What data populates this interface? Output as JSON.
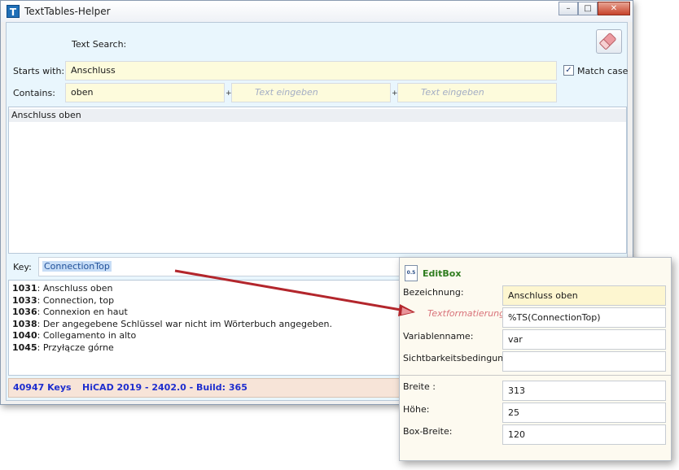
{
  "window": {
    "title": "TextTables-Helper",
    "icon_letter": "T"
  },
  "window_controls": {
    "minimize": "–",
    "maximize": "□",
    "close": "✕"
  },
  "search": {
    "heading": "Text Search:",
    "starts_with_label": "Starts with:",
    "starts_with_value": "Anschluss",
    "contains_label": "Contains:",
    "contains_value": "oben",
    "contains_placeholder_2": "Text eingeben",
    "contains_placeholder_3": "Text eingeben",
    "plus": "+",
    "match_case_label": "Match case",
    "match_case_checked": true
  },
  "results": [
    "Anschluss oben"
  ],
  "key": {
    "label": "Key:",
    "value": "ConnectionTop"
  },
  "translations": [
    {
      "id": "1031",
      "text": ": Anschluss oben"
    },
    {
      "id": "1033",
      "text": ": Connection, top"
    },
    {
      "id": "1036",
      "text": ": Connexion en haut"
    },
    {
      "id": "1038",
      "text": ": Der angegebene Schlüssel war nicht im Wörterbuch angegeben."
    },
    {
      "id": "1040",
      "text": ": Collegamento in alto"
    },
    {
      "id": "1045",
      "text": ": Przyłącze górne"
    }
  ],
  "status": {
    "keys": "40947 Keys",
    "build": "HiCAD 2019 - 2402.0 - Build: 365"
  },
  "editbox": {
    "title": "EditBox",
    "icon_text": "0.5",
    "fields": [
      {
        "label": "Bezeichnung:",
        "value": "Anschluss oben"
      },
      {
        "label": "Textformatierung:",
        "value": "%TS(ConnectionTop)"
      },
      {
        "label": "Variablenname:",
        "value": "var"
      },
      {
        "label": "Sichtbarkeitsbedingung:",
        "value": ""
      },
      {
        "label": "Breite :",
        "value": "313"
      },
      {
        "label": "Höhe:",
        "value": "25"
      },
      {
        "label": "Box-Breite:",
        "value": "120"
      }
    ]
  },
  "colors": {
    "accent_blue": "#1e2ecf",
    "arrow_red": "#c8202a",
    "field_yellow": "#fdfbdc",
    "client_bg": "#e9f6fd"
  },
  "icons": {
    "app": "app-t-icon",
    "clear": "eraser-icon",
    "editbox": "editbox-icon",
    "arrow": "annotation-arrow"
  }
}
